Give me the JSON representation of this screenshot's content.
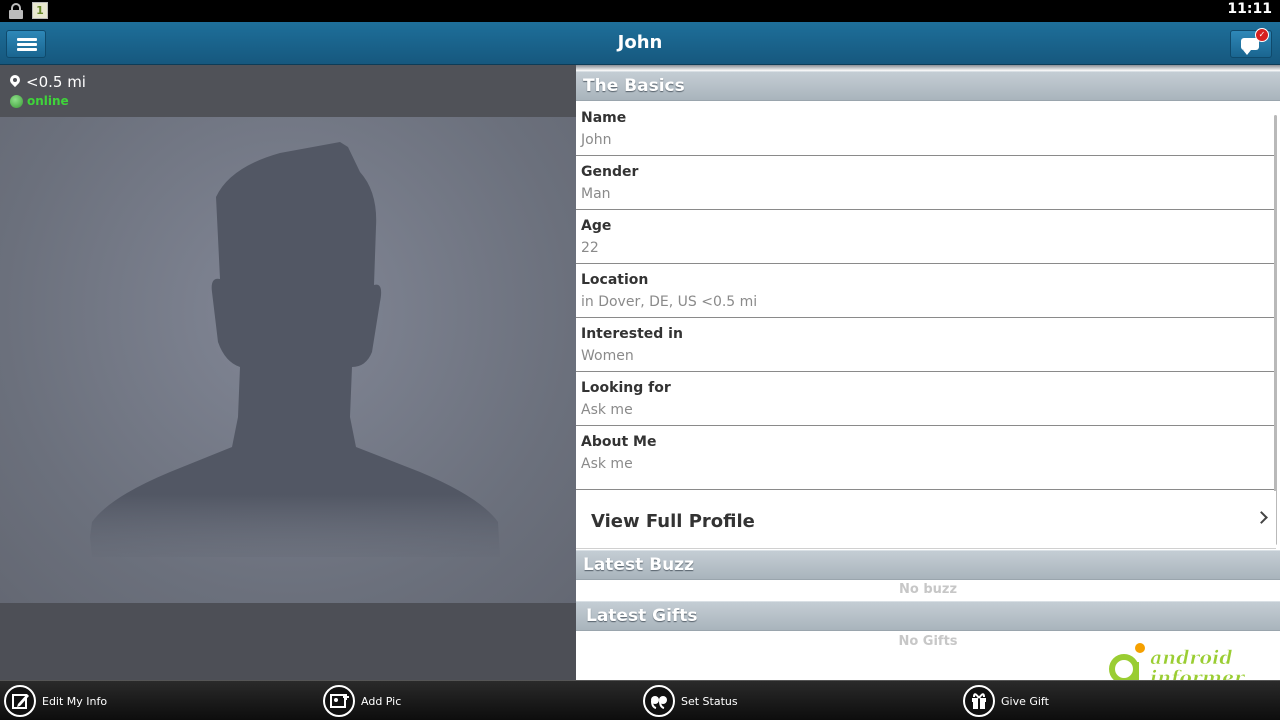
{
  "status_bar": {
    "time": "11:11",
    "notif_digit": "1"
  },
  "action_bar": {
    "title": "John",
    "chat_badge": "✓"
  },
  "left": {
    "distance": "<0.5 mi",
    "status": "online"
  },
  "basics": {
    "header": "The Basics",
    "rows": [
      {
        "label": "Name",
        "value": "John"
      },
      {
        "label": "Gender",
        "value": "Man"
      },
      {
        "label": "Age",
        "value": "22"
      },
      {
        "label": "Location",
        "value": "in Dover, DE, US <0.5 mi"
      },
      {
        "label": "Interested in",
        "value": "Women"
      },
      {
        "label": "Looking for",
        "value": "Ask me"
      },
      {
        "label": "About Me",
        "value": "Ask me"
      }
    ]
  },
  "full_profile": "View Full Profile",
  "buzz": {
    "header": "Latest Buzz",
    "empty": "No buzz"
  },
  "gifts": {
    "header": "Latest Gifts",
    "empty": "No Gifts"
  },
  "watermark": {
    "line1": "android",
    "line2": "informer"
  },
  "bottom_bar": {
    "edit": "Edit My Info",
    "add_pic": "Add Pic",
    "set_status": "Set Status",
    "give_gift": "Give Gift"
  },
  "colors": {
    "action_bar": "#1e6f9a",
    "online": "#3fd43a",
    "section_header": "#b4bec6",
    "watermark_green": "#9acd32",
    "watermark_orange": "#f5a000"
  }
}
